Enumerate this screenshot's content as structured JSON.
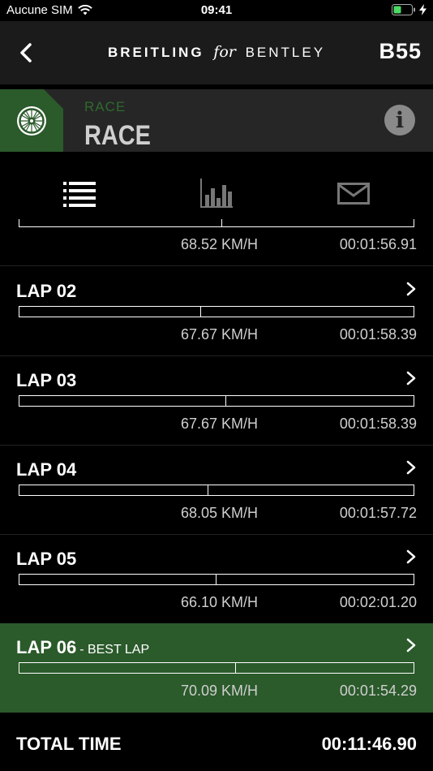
{
  "status_bar": {
    "carrier": "Aucune SIM",
    "time": "09:41",
    "icons": [
      "wifi-icon",
      "battery-icon",
      "charging-bolt-icon"
    ]
  },
  "nav": {
    "back_icon": "chevron-left-icon",
    "brand_left": "BREITLING",
    "brand_for": "for",
    "brand_right": "BENTLEY",
    "model": "B55"
  },
  "mode": {
    "icon": "wheel-icon",
    "subtitle": "RACE",
    "title": "RACE",
    "info_icon": "info-icon",
    "info_symbol": "i"
  },
  "tabs": [
    {
      "name": "list-view",
      "icon": "list-icon",
      "active": true
    },
    {
      "name": "chart-view",
      "icon": "bar-chart-icon",
      "active": false
    },
    {
      "name": "share",
      "icon": "envelope-icon",
      "active": false
    }
  ],
  "laps": [
    {
      "label": "",
      "best_label": "",
      "speed": "68.52 KM/H",
      "time": "00:01:56.91",
      "marker": 0.513,
      "best": false,
      "partial": true
    },
    {
      "label": "LAP 02",
      "best_label": "",
      "speed": "67.67 KM/H",
      "time": "00:01:58.39",
      "marker": 0.458,
      "best": false,
      "partial": false
    },
    {
      "label": "LAP 03",
      "best_label": "",
      "speed": "67.67 KM/H",
      "time": "00:01:58.39",
      "marker": 0.523,
      "best": false,
      "partial": false
    },
    {
      "label": "LAP 04",
      "best_label": "",
      "speed": "68.05 KM/H",
      "time": "00:01:57.72",
      "marker": 0.478,
      "best": false,
      "partial": false
    },
    {
      "label": "LAP 05",
      "best_label": "",
      "speed": "66.10 KM/H",
      "time": "00:02:01.20",
      "marker": 0.498,
      "best": false,
      "partial": false
    },
    {
      "label": "LAP 06",
      "best_label": "- BEST LAP",
      "speed": "70.09 KM/H",
      "time": "00:01:54.29",
      "marker": 0.548,
      "best": true,
      "partial": false
    }
  ],
  "footer": {
    "label": "TOTAL TIME",
    "value": "00:11:46.90"
  },
  "colors": {
    "accent_green": "#2b5a2b",
    "subtitle_green": "#2f6a2f",
    "nav_bg": "#1b1b1b",
    "mode_bg": "#262626"
  }
}
